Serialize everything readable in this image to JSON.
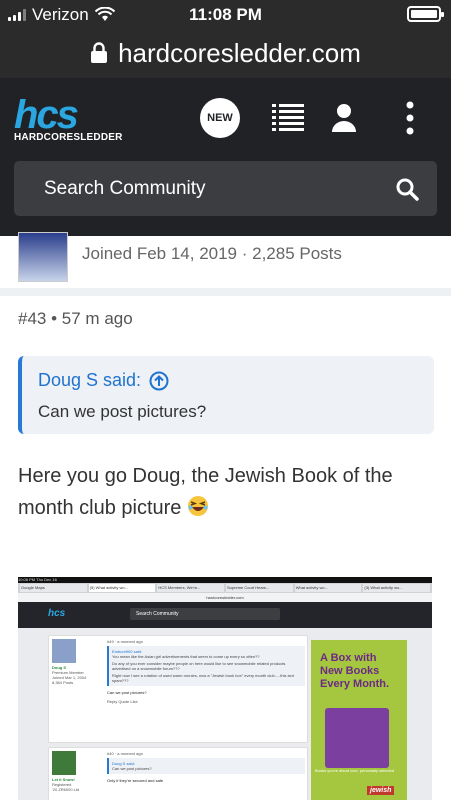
{
  "status": {
    "carrier": "Verizon",
    "time": "11:08 PM"
  },
  "browser": {
    "url": "hardcoresledder.com"
  },
  "header": {
    "logo_text": "hcs",
    "logo_sub": "HARDCORESLEDDER",
    "new_badge": "NEW",
    "search_placeholder": "Search Community"
  },
  "author": {
    "joined": "Joined Feb 14, 2019 · 2,285 Posts"
  },
  "post": {
    "number": "#43",
    "age": "57 m ago",
    "quote_author": "Doug S said:",
    "quote_text": "Can we post pictures?",
    "body": "Here you go Doug, the Jewish Book of the month club picture"
  },
  "embedded": {
    "statusbar": "10:08 PM  Thu Dec 16",
    "tabs": [
      "Google Maps",
      "(5) What activity wo...",
      "HCS Members, We're...",
      "Supreme Court Hears...",
      "What activity wo...",
      "(3) What activity wo..."
    ],
    "url": "hardcoresledder.com",
    "logo": "hcs",
    "search": "Search Community",
    "post1_meta": "#49 · a moment ago",
    "post1_quote_author": "Embum900 said:",
    "post1_quote": "You mean like the Asian girl advertisements that seem to come up every so often??",
    "post1_line2": "Do any of you ever consider maybe people on here would like to see snowmobile related products advertised on a snowmobile forum???",
    "post1_line3": "Right now I see a rotation of used warm ronnies, now a \"Jewish book box\" every month club.....this isnt spam???",
    "post1_reply": "Can we post pictures?",
    "post1_actions": "Reply   Quote   Like",
    "user1": "Doug S",
    "user1_role": "Premium Member",
    "user1_joined": "Joined Mar 1, 2004",
    "user1_posts": "8,384 Posts",
    "post2_meta": "#40 · a moment ago",
    "post2_quote_author": "Doug S said:",
    "post2_quote": "Can we post pictures?",
    "post2_body": "Only if they're secured and safe",
    "user2": "Let it Snow!",
    "user2_role": "Registered",
    "user2_joined": "'20 ZR6000 Ltd",
    "ad_title": "A Box with New Books Every Month.",
    "ad_tag": "Books you're about love, personally selected",
    "ad_brand": "jewish"
  },
  "colors": {
    "header_bg": "#202226",
    "accent": "#2aa7e0",
    "quote_link": "#1f73d0",
    "ad_bg": "#a5c63f"
  }
}
